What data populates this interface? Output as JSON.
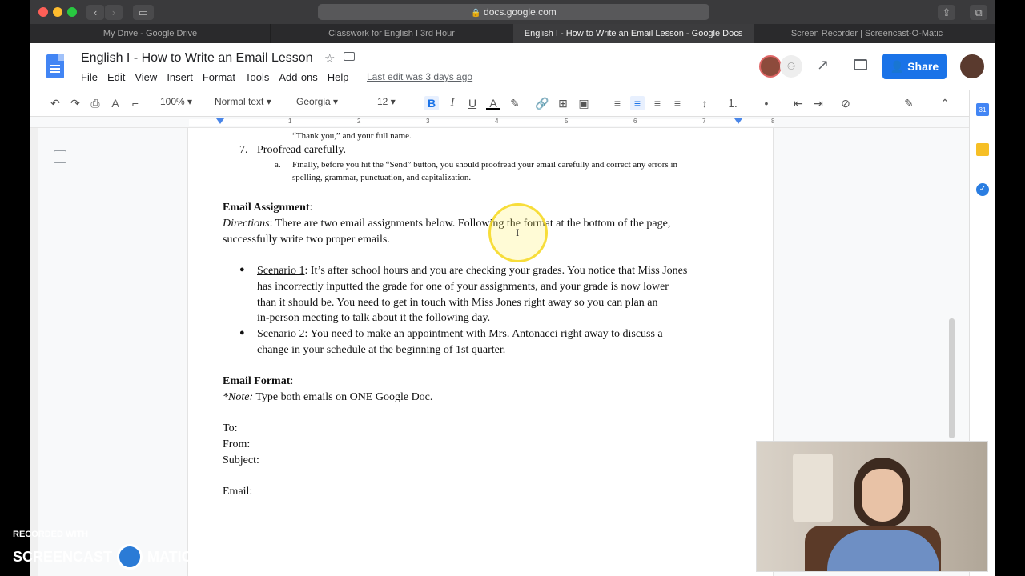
{
  "browser": {
    "url": "docs.google.com",
    "tabs": [
      {
        "label": "My Drive - Google Drive"
      },
      {
        "label": "Classwork for English I 3rd Hour"
      },
      {
        "label": "English I - How to Write an Email Lesson - Google Docs"
      },
      {
        "label": "Screen Recorder | Screencast-O-Matic"
      }
    ]
  },
  "docs": {
    "title": "English I - How to Write an Email Lesson",
    "menus": [
      "File",
      "Edit",
      "View",
      "Insert",
      "Format",
      "Tools",
      "Add-ons",
      "Help"
    ],
    "last_edit": "Last edit was 3 days ago",
    "share_label": "Share"
  },
  "toolbar": {
    "zoom": "100%",
    "style": "Normal text",
    "font": "Georgia",
    "size": "12",
    "bold": "B",
    "italic": "I",
    "underline": "U",
    "text_color": "A"
  },
  "ruler": {
    "numbers": [
      "1",
      "2",
      "3",
      "4",
      "5",
      "6",
      "7",
      "8"
    ]
  },
  "document": {
    "top_line": "“Thank you,” and your full name.",
    "item7_num": "7.",
    "item7_title": "Proofread carefully.",
    "item7a_letter": "a.",
    "item7a_line1": "Finally, before you hit the “Send” button, you should proofread your email carefully and correct any errors in",
    "item7a_line2": "spelling, grammar, punctuation, and capitalization.",
    "assignment_heading": "Email Assignment",
    "colon": ":",
    "directions_label": "Directions",
    "directions_line1_rest": ": There are two email assignments below. Following the format at the bottom of the page,",
    "directions_line2": "successfully write two proper emails.",
    "bullet": "●",
    "scenario1_label": "Scenario 1",
    "scenario1_line1_rest": ": It’s after school hours and you are checking your grades. You notice that Miss Jones",
    "scenario1_line2": "has incorrectly inputted the grade for one of your assignments, and your grade is now lower",
    "scenario1_line3": "than it should be. You need to get in touch with Miss Jones right away so you can plan an",
    "scenario1_line4": "in-person meeting to talk about it the following day.",
    "scenario2_label": "Scenario 2",
    "scenario2_line1_rest": ": You need to make an appointment with Mrs. Antonacci right away to discuss a",
    "scenario2_line2": "change in your schedule at the beginning of 1st quarter.",
    "format_heading": "Email Format",
    "note_label": "*Note:",
    "note_rest": " Type both emails on ONE Google Doc.",
    "to": "To:",
    "from": "From:",
    "subject": "Subject:",
    "email": "Email:"
  },
  "watermark": {
    "recorded_with": "RECORDED WITH",
    "brand_left": "SCREENCAST",
    "brand_right": "MATIC"
  },
  "colors": {
    "share_blue": "#1a73e8",
    "docs_blue": "#4285f4",
    "highlight_ring": "#f6d71e"
  }
}
